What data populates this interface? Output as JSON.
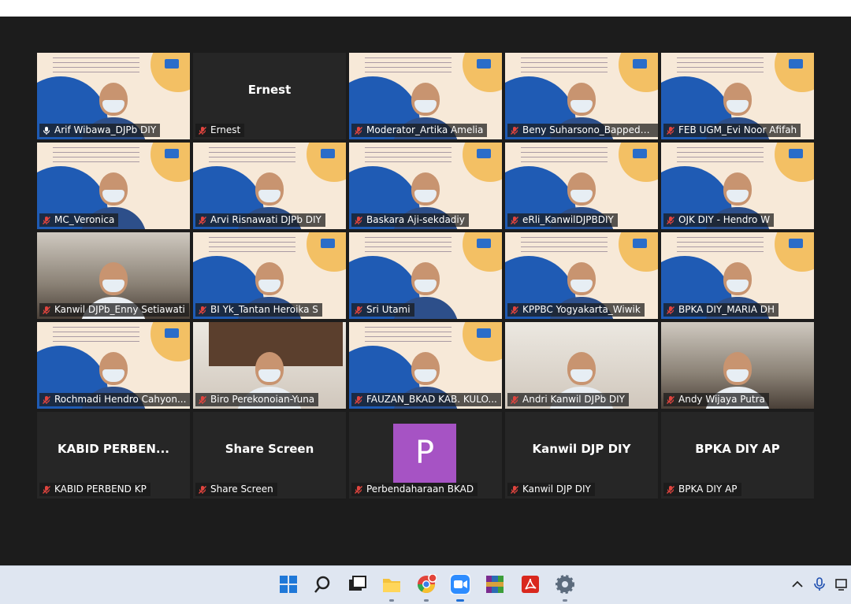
{
  "participants": [
    {
      "name": "Arif Wibawa_DJPb DIY",
      "video": "slide",
      "active": true,
      "muted": false
    },
    {
      "name": "Ernest",
      "display_name": "Ernest",
      "video": "none",
      "muted": true
    },
    {
      "name": "Moderator_Artika Amelia",
      "video": "slide",
      "muted": true
    },
    {
      "name": "Beny Suharsono_Bappeda ...",
      "video": "slide",
      "muted": true
    },
    {
      "name": "FEB UGM_Evi Noor Afifah",
      "video": "slide",
      "muted": true
    },
    {
      "name": "MC_Veronica",
      "video": "slide",
      "muted": true
    },
    {
      "name": "Arvi Risnawati DJPb DIY",
      "video": "slide",
      "muted": true
    },
    {
      "name": "Baskara  Aji-sekdadiy",
      "video": "slide",
      "muted": true
    },
    {
      "name": "eRli_KanwilDJPBDIY",
      "video": "slide",
      "muted": true
    },
    {
      "name": "OJK DIY - Hendro W",
      "video": "slide",
      "muted": true
    },
    {
      "name": "Kanwil DJPb_Enny Setiawati",
      "video": "room",
      "muted": true
    },
    {
      "name": "BI Yk_Tantan Heroika S",
      "video": "slide",
      "muted": true
    },
    {
      "name": "Sri Utami",
      "video": "slide",
      "muted": true
    },
    {
      "name": "KPPBC Yogyakarta_Wiwik",
      "video": "slide",
      "muted": true
    },
    {
      "name": "BPKA DIY_MARIA DH",
      "video": "slide",
      "muted": true
    },
    {
      "name": "Rochmadi Hendro Cahyon...",
      "video": "slide",
      "muted": true
    },
    {
      "name": "Biro Perekonoian-Yuna",
      "video": "office",
      "muted": true
    },
    {
      "name": "FAUZAN_BKAD KAB. KULO...",
      "video": "slide",
      "muted": true
    },
    {
      "name": "Andri Kanwil DJPb DIY",
      "video": "office",
      "muted": true
    },
    {
      "name": "Andy Wijaya Putra",
      "video": "room",
      "muted": true
    },
    {
      "name": "KABID PERBEND KP",
      "display_name": "KABID PERBEN...",
      "video": "none",
      "muted": true
    },
    {
      "name": "Share Screen",
      "display_name": "Share Screen",
      "video": "none",
      "muted": true
    },
    {
      "name": "Perbendaharaan BKAD",
      "avatar_letter": "P",
      "video": "avatar",
      "muted": true
    },
    {
      "name": "Kanwil DJP DIY",
      "display_name": "Kanwil DJP DIY",
      "video": "none",
      "muted": true
    },
    {
      "name": "BPKA DIY AP",
      "display_name": "BPKA DIY AP",
      "video": "none",
      "muted": true
    }
  ],
  "taskbar": {
    "icons": [
      "windows-start-icon",
      "search-icon",
      "task-view-icon",
      "file-explorer-icon",
      "chrome-icon",
      "zoom-icon",
      "winrar-icon",
      "acrobat-icon",
      "settings-icon"
    ],
    "tray": [
      "chevron-up-icon",
      "microphone-icon",
      "network-icon"
    ]
  },
  "colors": {
    "active_border": "#9ad13b",
    "meeting_bg": "#1c1c1c",
    "avatar_bg": "#a653c4",
    "mute_red": "#e0443e"
  }
}
